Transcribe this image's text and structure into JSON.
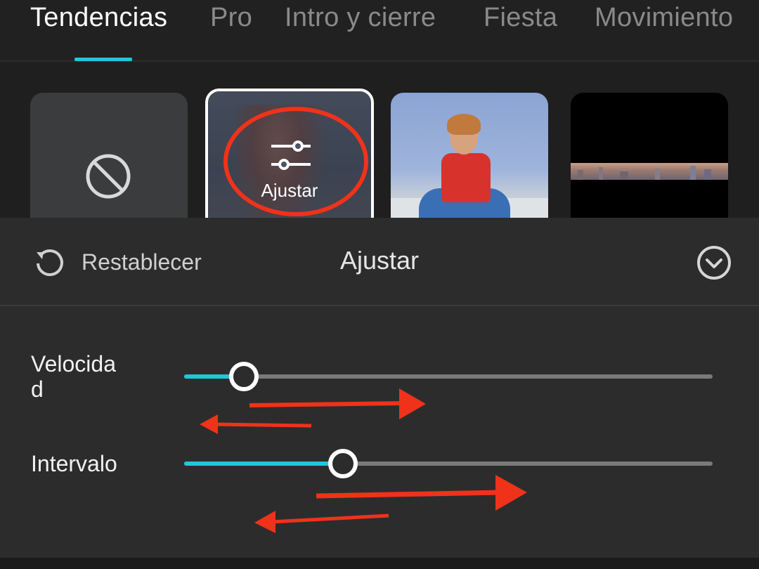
{
  "tabs": [
    {
      "label": "Tendencias",
      "active": true
    },
    {
      "label": "Pro",
      "active": false
    },
    {
      "label": "Intro y cierre",
      "active": false
    },
    {
      "label": "Fiesta",
      "active": false
    },
    {
      "label": "Movimiento",
      "active": false
    }
  ],
  "effects": {
    "none_icon": "prohibited-icon",
    "adjust_label": "Ajustar",
    "adjust_icon": "sliders-icon"
  },
  "panel": {
    "reset_label": "Restablecer",
    "title": "Ajustar",
    "collapse_icon": "chevron-down-circle-icon"
  },
  "sliders": [
    {
      "label": "Velocida\nd",
      "value": 0.113
    },
    {
      "label": "Intervalo",
      "value": 0.3
    }
  ],
  "colors": {
    "accent": "#1ec8d8",
    "annotation": "#f0321a"
  }
}
